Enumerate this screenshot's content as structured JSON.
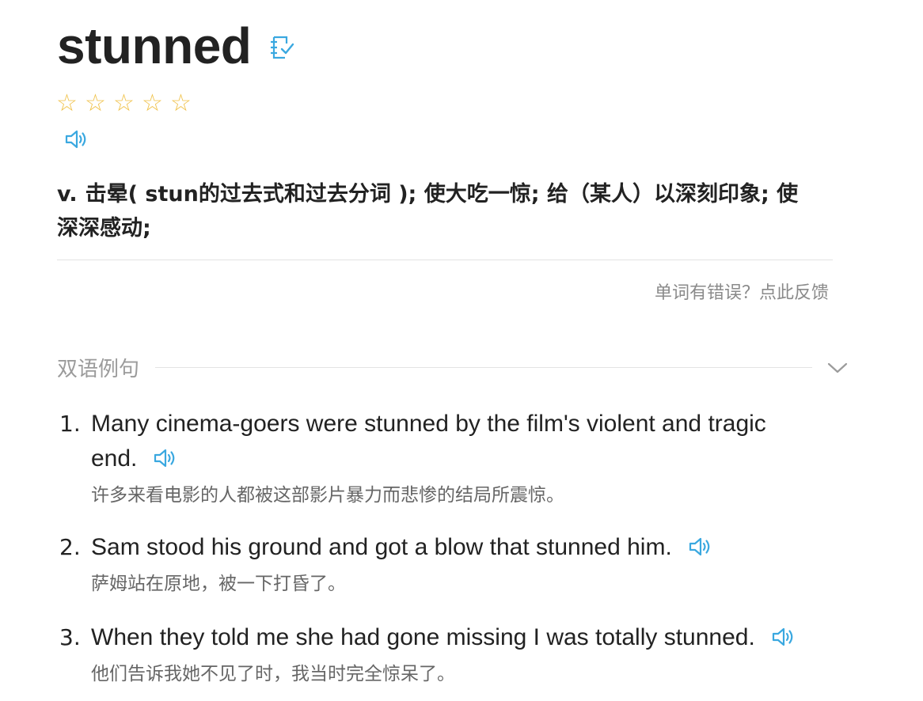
{
  "word": {
    "headword": "stunned",
    "wordbook_icon": "wordbook-add-icon",
    "rating": {
      "filled": 0,
      "total": 5,
      "star_symbol": "☆"
    },
    "pronunciation_icon": "speaker-icon"
  },
  "definition": {
    "pos": "v.",
    "text": "击晕( stun的过去式和过去分词 ); 使大吃一惊; 给（某人）以深刻印象; 使深深感动;"
  },
  "feedback_link": "单词有错误？点此反馈",
  "examples_section": {
    "title": "双语例句",
    "toggle_icon": "chevron-down-icon",
    "items": [
      {
        "num": "1.",
        "en": "Many cinema-goers were stunned by the film's violent and tragic end.",
        "zh": "许多来看电影的人都被这部影片暴力而悲惨的结局所震惊。"
      },
      {
        "num": "2.",
        "en": "Sam stood his ground and got a blow that stunned him.",
        "zh": "萨姆站在原地，被一下打昏了。"
      },
      {
        "num": "3.",
        "en": "When they told me she had gone missing I was totally stunned.",
        "zh": "他们告诉我她不见了时，我当时完全惊呆了。"
      }
    ]
  },
  "colors": {
    "accent": "#3aa8e0",
    "star": "#f0c24a",
    "muted": "#9b9b9b",
    "text": "#222222"
  }
}
